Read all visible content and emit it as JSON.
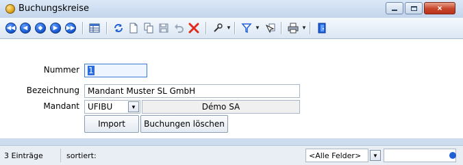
{
  "window": {
    "title": "Buchungskreise",
    "buttons": {
      "minimize": "minimize",
      "maximize": "maximize",
      "close": "×"
    }
  },
  "toolbar": {
    "nav": [
      {
        "name": "first-record",
        "glyph": "◀◀"
      },
      {
        "name": "previous-page",
        "glyph": "◀"
      },
      {
        "name": "previous-record",
        "glyph": "◆"
      },
      {
        "name": "next-record",
        "glyph": "▶"
      },
      {
        "name": "last-record",
        "glyph": "▶▶"
      }
    ]
  },
  "form": {
    "nummer": {
      "label": "Nummer",
      "value": "1"
    },
    "bezeichnung": {
      "label": "Bezeichnung",
      "value": "Mandant Muster SL GmbH"
    },
    "mandant": {
      "label": "Mandant",
      "value": "UFIBU",
      "name": "Démo SA"
    },
    "import_label": "Import",
    "delete_label": "Buchungen löschen"
  },
  "status": {
    "count": "3 Einträge",
    "sorted": "sortiert:",
    "filter_value": "<Alle Felder>"
  },
  "colors": {
    "accent": "#1f5fd6",
    "close": "#c8442a"
  }
}
